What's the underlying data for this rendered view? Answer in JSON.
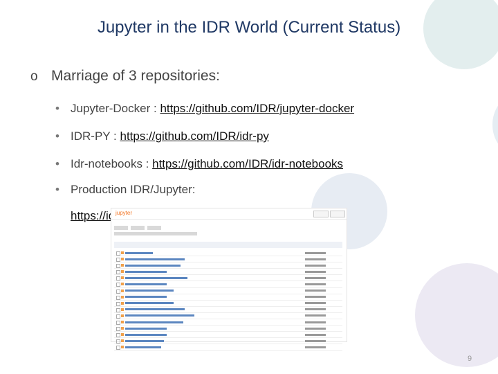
{
  "slide": {
    "title": "Jupyter in the IDR World (Current Status)",
    "main_bullet_marker": "o",
    "main_point": "Marriage of 3 repositories:",
    "sub_bullet_marker": "•",
    "items": [
      {
        "label": "Jupyter-Docker : ",
        "link": "https://github.com/IDR/jupyter-docker"
      },
      {
        "label": "IDR-PY : ",
        "link": "https://github.com/IDR/idr-py"
      },
      {
        "label": "Idr-notebooks : ",
        "link": "https://github.com/IDR/idr-notebooks"
      },
      {
        "label": "Production IDR/Jupyter:",
        "link": ""
      }
    ],
    "production_url": "https://idr.openmicroscopy.org/jupyter/hub/home",
    "page_number": "9"
  },
  "screenshot": {
    "logo_text": "jupyter",
    "row_count": 16
  },
  "colors": {
    "title": "#1f3864",
    "body_text": "#444444",
    "decor_teal": "#e3eeee",
    "decor_blue": "#e7ecf3",
    "decor_purple": "#ece9f3"
  }
}
